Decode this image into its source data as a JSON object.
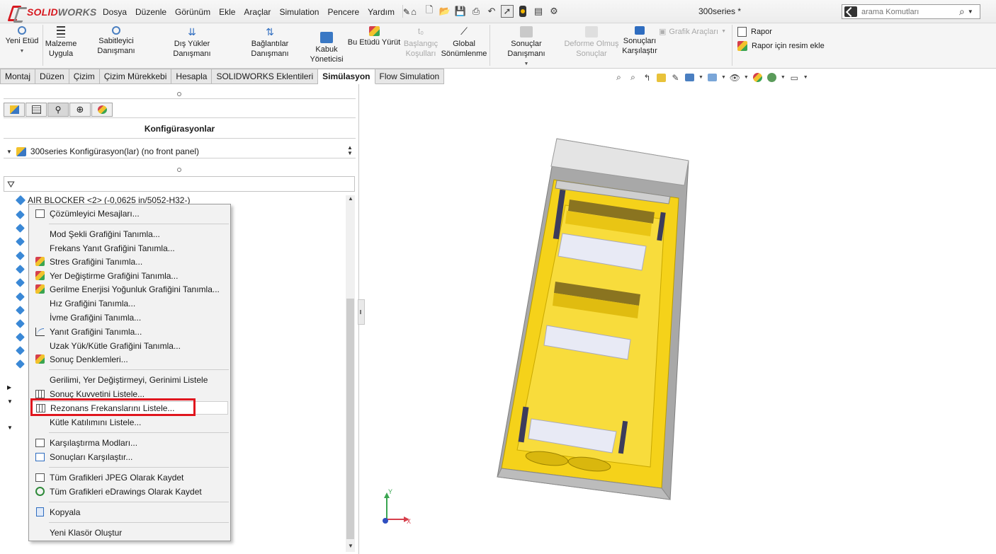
{
  "app": {
    "logo_solid": "SOLID",
    "logo_works": "WORKS",
    "document_title": "300series *",
    "search_placeholder": "arama Komutları"
  },
  "menu": [
    "Dosya",
    "Düzenle",
    "Görünüm",
    "Ekle",
    "Araçlar",
    "Simulation",
    "Pencere",
    "Yardım"
  ],
  "toolbar": {
    "yeni_etud": "Yeni Etüd",
    "malzeme_1": "Malzeme",
    "malzeme_2": "Uygula",
    "sabitleyici": "Sabitleyici Danışmanı",
    "dis_yukler": "Dış Yükler Danışmanı",
    "baglantilar": "Bağlantılar Danışmanı",
    "kabuk_1": "Kabuk",
    "kabuk_2": "Yöneticisi",
    "bu_etudu": "Bu Etüdü Yürüt",
    "baslangic_1": "Başlangıç",
    "baslangic_2": "Koşulları",
    "global_1": "Global",
    "global_2": "Sönümlenme",
    "sonuclar_danismani": "Sonuçlar Danışmanı",
    "deforme_1": "Deforme Olmuş",
    "deforme_2": "Sonuçlar",
    "sonuclari_1": "Sonuçları",
    "sonuclari_2": "Karşılaştır",
    "grafik_araclari": "Grafik Araçları",
    "rapor": "Rapor",
    "rapor_resim": "Rapor için resim ekle"
  },
  "tabs": [
    {
      "label": "Montaj",
      "active": false
    },
    {
      "label": "Düzen",
      "active": false
    },
    {
      "label": "Çizim",
      "active": false
    },
    {
      "label": "Çizim Mürekkebi",
      "active": false
    },
    {
      "label": "Hesapla",
      "active": false
    },
    {
      "label": "SOLIDWORKS Eklentileri",
      "active": false
    },
    {
      "label": "Simülasyon",
      "active": true
    },
    {
      "label": "Flow Simulation",
      "active": false
    }
  ],
  "panel": {
    "header": "Konfigürasyonlar",
    "configuration": "300series Konfigürasyon(lar)  (no front panel)",
    "first_item": "AIR BLOCKER <2> (-0,0625 in/5052-H32-)"
  },
  "context_menu": {
    "items": [
      {
        "label": "Çözümleyici Mesajları...",
        "icon": "message-icon",
        "hotkey_index": 0
      },
      {
        "label": "Mod Şekli Grafiğini Tanımla...",
        "icon": "none"
      },
      {
        "label": "Frekans Yanıt Grafiğini Tanımla...",
        "icon": "none"
      },
      {
        "label": "Stres Grafiğini Tanımla...",
        "icon": "stress-plot-icon"
      },
      {
        "label": "Yer Değiştirme Grafiğini Tanımla...",
        "icon": "displacement-plot-icon"
      },
      {
        "label": "Gerilme Enerjisi Yoğunluk Grafiğini Tanımla...",
        "icon": "strain-energy-icon"
      },
      {
        "label": "Hız Grafiğini Tanımla...",
        "icon": "none"
      },
      {
        "label": "İvme Grafiğini Tanımla...",
        "icon": "none"
      },
      {
        "label": "Yanıt Grafiğini Tanımla...",
        "icon": "response-graph-icon"
      },
      {
        "label": "Uzak Yük/Kütle Grafiğini Tanımla...",
        "icon": "none"
      },
      {
        "label": "Sonuç Denklemleri...",
        "icon": "result-equations-icon"
      },
      {
        "label": "Gerilimi, Yer Değiştirmeyi, Gerinimi Listele",
        "icon": "none"
      },
      {
        "label": "Sonuç Kuvvetini Listele...",
        "icon": "result-force-icon"
      },
      {
        "label": "Rezonans Frekanslarını Listele...",
        "icon": "resonance-list-icon"
      },
      {
        "label": "Kütle Katılımını Listele...",
        "icon": "none"
      },
      {
        "label": "Karşılaştırma Modları...",
        "icon": "compare-modes-icon"
      },
      {
        "label": "Sonuçları Karşılaştır...",
        "icon": "compare-results-icon"
      },
      {
        "label": "Tüm Grafikleri JPEG Olarak Kaydet",
        "icon": "save-jpeg-icon"
      },
      {
        "label": "Tüm Grafikleri eDrawings Olarak Kaydet",
        "icon": "edrawings-icon"
      },
      {
        "label": "Kopyala",
        "icon": "copy-icon"
      },
      {
        "label": "Yeni Klasör Oluştur",
        "icon": "none"
      }
    ],
    "highlighted": "Rezonans Frekanslarını Listele..."
  },
  "triad": {
    "x": "X",
    "y": "Y"
  },
  "colors": {
    "accent_red": "#e0161e",
    "brand_red": "#d71920",
    "model_yellow": "#f5d21a",
    "model_grey": "#a9a9a9",
    "tree_blue": "#3a88d6"
  }
}
